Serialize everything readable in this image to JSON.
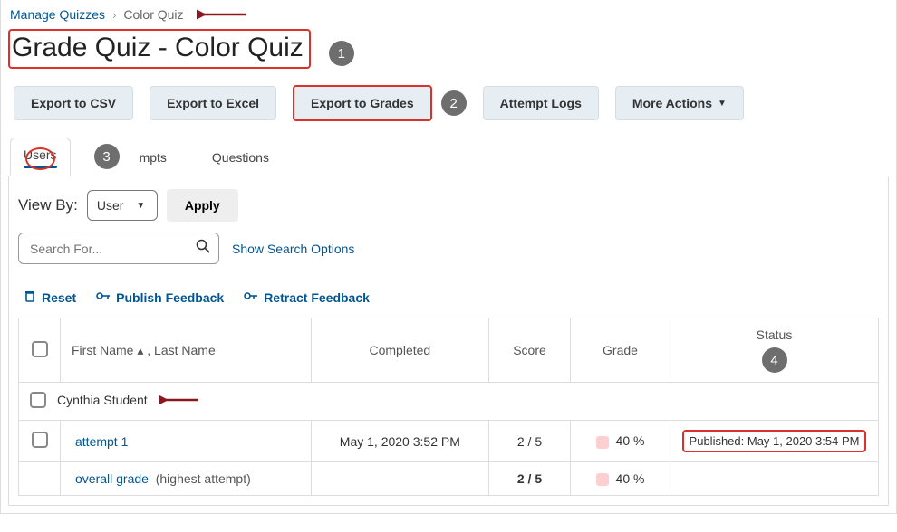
{
  "breadcrumb": {
    "root": "Manage Quizzes",
    "current": "Color Quiz"
  },
  "page_title": "Grade Quiz - Color Quiz",
  "actions": {
    "export_csv": "Export to CSV",
    "export_excel": "Export to Excel",
    "export_grades": "Export to Grades",
    "attempt_logs": "Attempt Logs",
    "more_actions": "More Actions"
  },
  "tabs": {
    "users": "Users",
    "attempts_partial": "mpts",
    "questions": "Questions"
  },
  "filters": {
    "view_by_label": "View By:",
    "view_by_value": "User",
    "apply_label": "Apply",
    "search_placeholder": "Search For...",
    "show_search_options": "Show Search Options"
  },
  "feedback_actions": {
    "reset": "Reset",
    "publish": "Publish Feedback",
    "retract": "Retract Feedback"
  },
  "table": {
    "headers": {
      "name": "First Name ▴ , Last Name",
      "completed": "Completed",
      "score": "Score",
      "grade": "Grade",
      "status": "Status"
    },
    "student_name": "Cynthia Student",
    "attempt": {
      "label": "attempt 1",
      "completed": "May 1, 2020 3:52 PM",
      "score": "2 / 5",
      "grade": "40 %",
      "status": "Published: May 1, 2020 3:54 PM"
    },
    "overall": {
      "label": "overall grade",
      "note": "(highest attempt)",
      "score": "2 / 5",
      "grade": "40 %"
    }
  },
  "annotations": [
    "1",
    "2",
    "3",
    "4"
  ]
}
